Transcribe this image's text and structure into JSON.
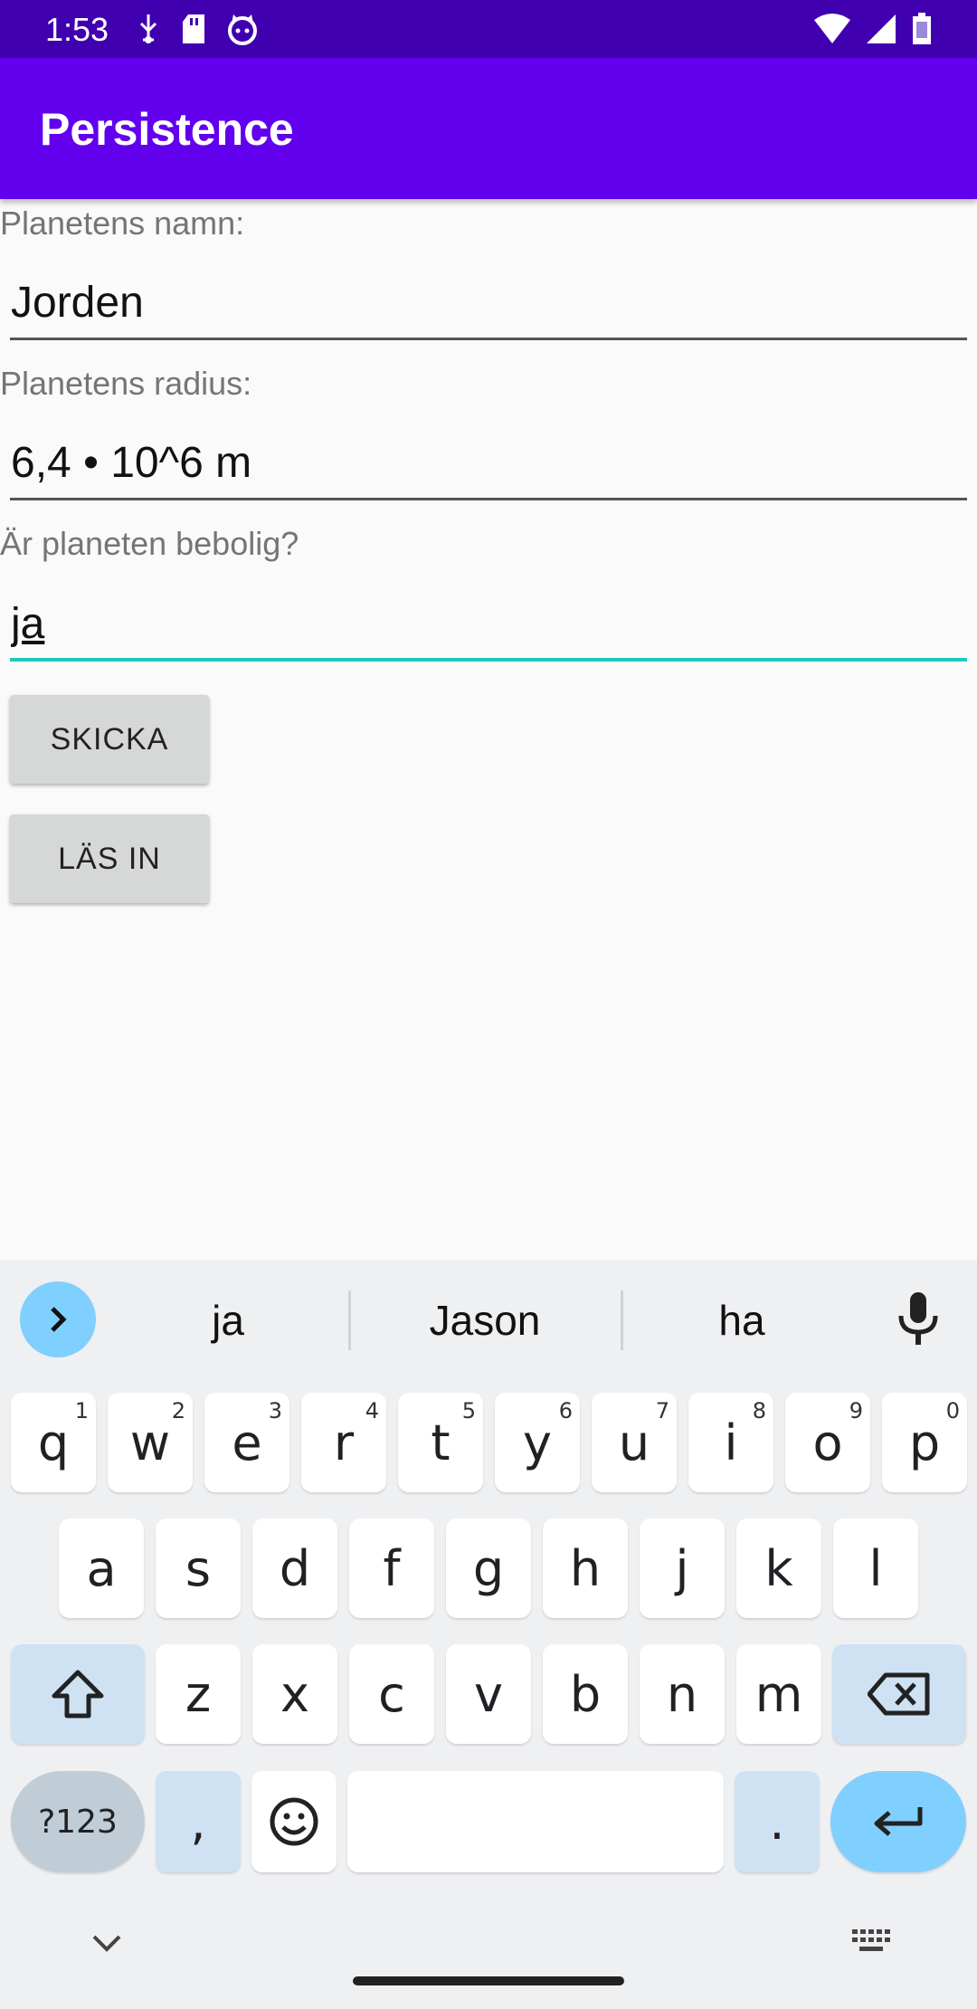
{
  "status_bar": {
    "time": "1:53",
    "left_icons": [
      "usb-debug-icon",
      "sd-card-icon",
      "cat-icon"
    ],
    "right_icons": [
      "wifi-icon",
      "signal-icon",
      "battery-icon"
    ]
  },
  "app_bar": {
    "title": "Persistence"
  },
  "form": {
    "name_label": "Planetens namn:",
    "name_value": "Jorden",
    "radius_label": "Planetens radius:",
    "radius_value": "6,4 • 10^6 m",
    "habitable_label": "Är planeten bebolig?",
    "habitable_value": "ja",
    "send_button": "SKICKA",
    "load_button": "LÄS IN"
  },
  "keyboard": {
    "suggestions": [
      "ja",
      "Jason",
      "ha"
    ],
    "row1": [
      {
        "k": "q",
        "s": "1"
      },
      {
        "k": "w",
        "s": "2"
      },
      {
        "k": "e",
        "s": "3"
      },
      {
        "k": "r",
        "s": "4"
      },
      {
        "k": "t",
        "s": "5"
      },
      {
        "k": "y",
        "s": "6"
      },
      {
        "k": "u",
        "s": "7"
      },
      {
        "k": "i",
        "s": "8"
      },
      {
        "k": "o",
        "s": "9"
      },
      {
        "k": "p",
        "s": "0"
      }
    ],
    "row2": [
      "a",
      "s",
      "d",
      "f",
      "g",
      "h",
      "j",
      "k",
      "l"
    ],
    "row3": [
      "z",
      "x",
      "c",
      "v",
      "b",
      "n",
      "m"
    ],
    "sym_label": "?123",
    "comma": ",",
    "period": ".",
    "accent_color": "#7fcfff"
  }
}
